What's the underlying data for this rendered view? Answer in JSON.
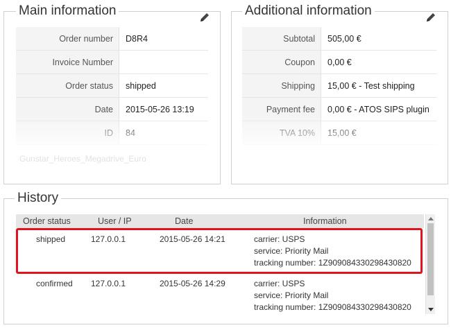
{
  "main_info": {
    "title": "Main information",
    "edit_icon": "pencil-icon",
    "rows": [
      {
        "label": "Order number",
        "value": "D8R4"
      },
      {
        "label": "Invoice Number",
        "value": ""
      },
      {
        "label": "Order status",
        "value": "shipped"
      },
      {
        "label": "Date",
        "value": "2015-05-26 13:19"
      },
      {
        "label": "ID",
        "value": "84"
      }
    ],
    "faded_text": "Gunstar_Heroes_Megadrive_Euro"
  },
  "additional_info": {
    "title": "Additional information",
    "edit_icon": "pencil-icon",
    "rows": [
      {
        "label": "Subtotal",
        "value": "505,00 €"
      },
      {
        "label": "Coupon",
        "value": "0,00 €"
      },
      {
        "label": "Shipping",
        "value": "15,00 € - Test shipping"
      },
      {
        "label": "Payment fee",
        "value": "0,00 € - ATOS SIPS plugin"
      },
      {
        "label": "TVA 10%",
        "value": "15,00 €"
      }
    ]
  },
  "history": {
    "title": "History",
    "columns": [
      "Order status",
      "User / IP",
      "Date",
      "Information"
    ],
    "rows": [
      {
        "status": "shipped",
        "user_ip": "127.0.0.1",
        "date": "2015-05-26 14:21",
        "info": [
          "carrier: USPS",
          "service: Priority Mail",
          "tracking number: 1Z909084330298430820"
        ]
      },
      {
        "status": "confirmed",
        "user_ip": "127.0.0.1",
        "date": "2015-05-26 14:29",
        "info": [
          "carrier: USPS",
          "service: Priority Mail",
          "tracking number: 1Z909084330298430820"
        ]
      }
    ],
    "highlight_color": "#e0141e"
  }
}
